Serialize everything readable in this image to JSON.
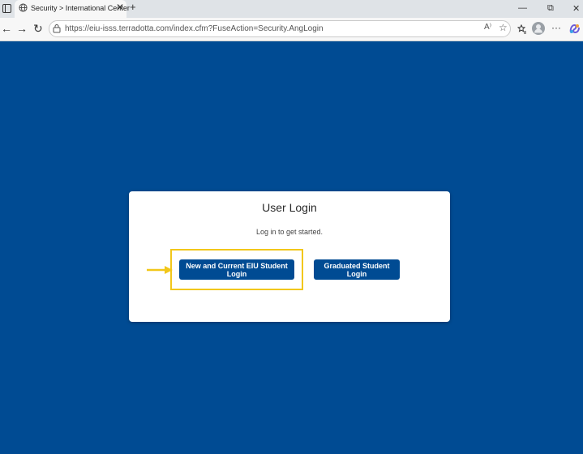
{
  "browser": {
    "tab_title": "Security > International Center",
    "tab_close": "✕",
    "new_tab": "+",
    "url": "https://eiu-isss.terradotta.com/index.cfm?FuseAction=Security.AngLogin",
    "read_aloud": "A⁾",
    "favorite": "☆",
    "back": "←",
    "forward": "→",
    "reload": "↻",
    "minimize": "—",
    "restore": "⧉",
    "close": "✕",
    "more": "···"
  },
  "login": {
    "title": "User Login",
    "subtitle": "Log in to get started.",
    "current_button": "New and Current EIU Student Login",
    "graduated_button": "Graduated Student Login"
  },
  "colors": {
    "brand_blue": "#004b93",
    "highlight": "#f2c71a"
  },
  "icons": [
    "sidebar-icon",
    "globe-icon",
    "lock-icon",
    "favorites-icon",
    "profile-avatar-icon",
    "copilot-icon",
    "highlight-arrow-icon"
  ]
}
